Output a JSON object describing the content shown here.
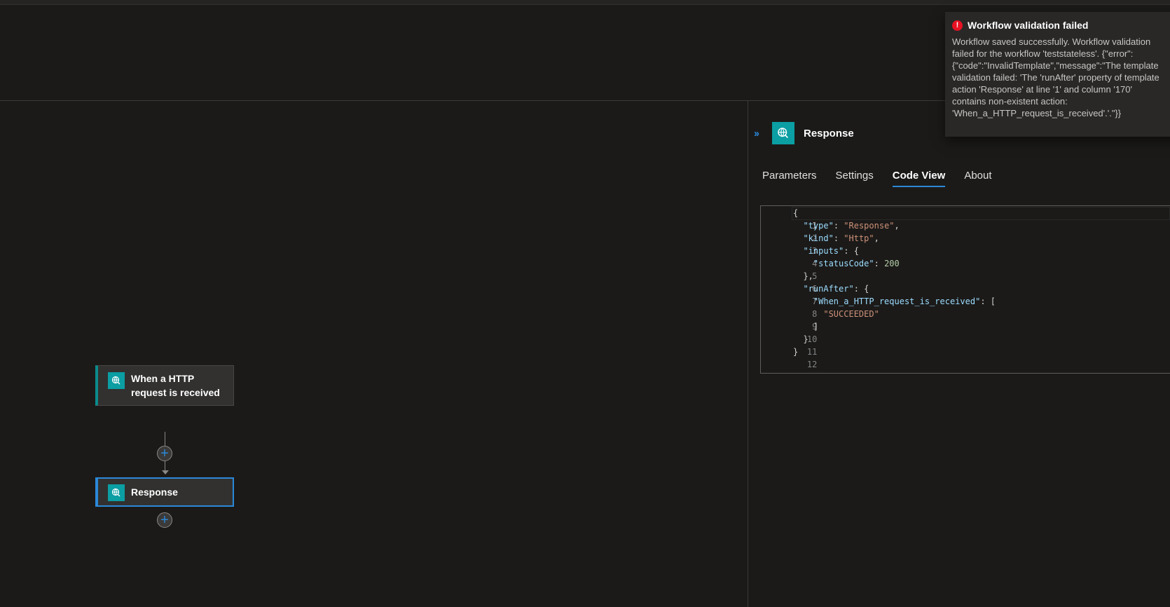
{
  "toast": {
    "title": "Workflow validation failed",
    "message": "Workflow saved successfully. Workflow validation failed for the workflow 'teststateless'. {\"error\":{\"code\":\"InvalidTemplate\",\"message\":\"The template validation failed: 'The 'runAfter' property of template action 'Response' at line '1' and column '170' contains non-existent action: 'When_a_HTTP_request_is_received'.'.\"}}",
    "icon": "error-circle-icon",
    "close_icon": "close-icon",
    "status_color": "#e81123"
  },
  "canvas": {
    "nodes": [
      {
        "title": "When a HTTP request is received",
        "icon": "http-globe-icon"
      },
      {
        "title": "Response",
        "icon": "http-globe-icon"
      }
    ],
    "add_icon": "plus-icon"
  },
  "panel": {
    "title": "Response",
    "collapse_icon": "double-chevron-right-icon",
    "icon": "http-globe-icon",
    "tabs": [
      {
        "label": "Parameters"
      },
      {
        "label": "Settings"
      },
      {
        "label": "Code View"
      },
      {
        "label": "About"
      }
    ],
    "active_tab": "Code View",
    "code_lines": [
      "1",
      "2",
      "3",
      "4",
      "5",
      "6",
      "7",
      "8",
      "9",
      "10",
      "11",
      "12"
    ],
    "code": {
      "type_key": "\"type\"",
      "type_val": "\"Response\"",
      "kind_key": "\"kind\"",
      "kind_val": "\"Http\"",
      "inputs_key": "\"inputs\"",
      "status_key": "\"statusCode\"",
      "status_val": "200",
      "runafter_key": "\"runAfter\"",
      "trigger_key": "\"When_a_HTTP_request_is_received\"",
      "succeeded": "\"SUCCEEDED\""
    }
  },
  "colors": {
    "accent": "#2b88d8",
    "connector_teal": "#0b9ea3",
    "background": "#1b1a19"
  }
}
